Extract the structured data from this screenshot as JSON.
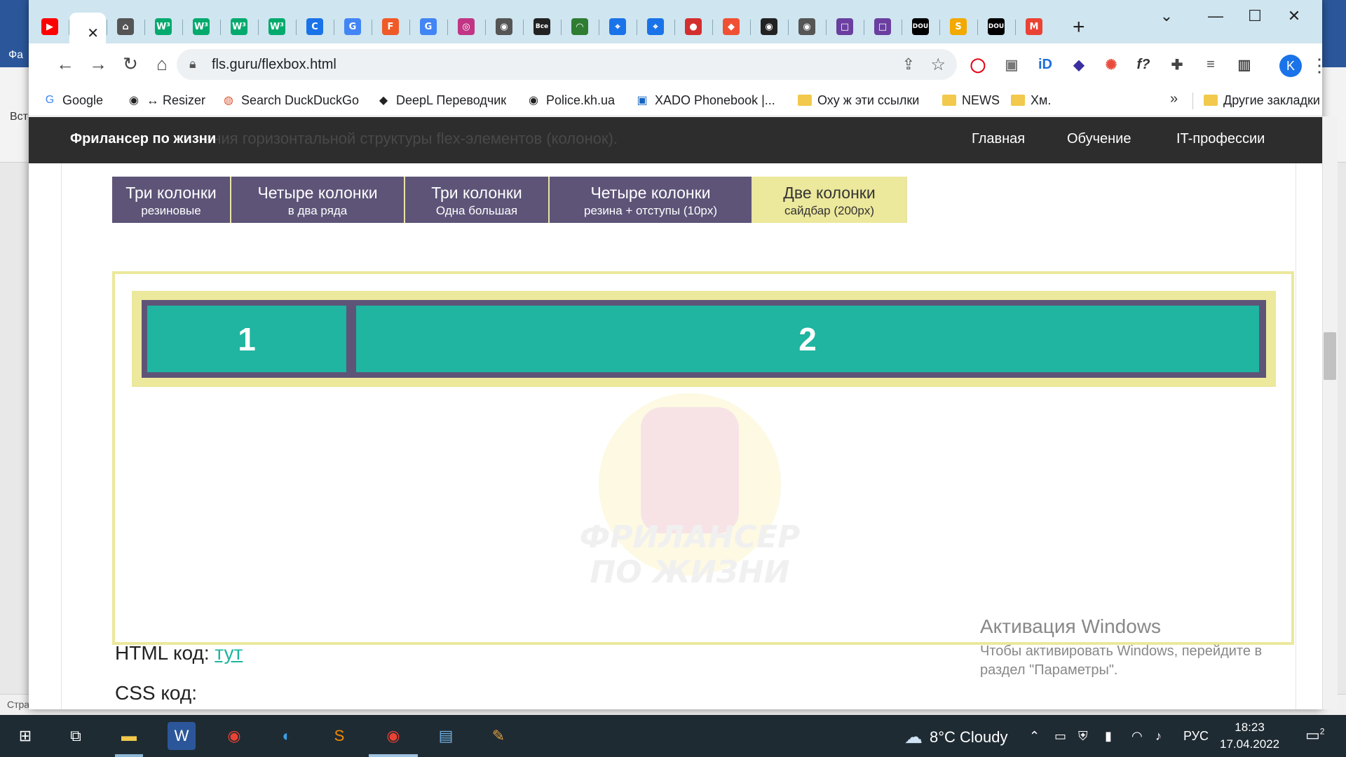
{
  "browser": {
    "url": "fls.guru/flexbox.html",
    "tabs": [
      {
        "icon": "youtube-icon",
        "color": "#ff0000",
        "glyph": "▶"
      },
      {
        "icon": "x-icon",
        "color": "#ffffff",
        "glyph": "",
        "active": true
      },
      {
        "icon": "bag-icon",
        "color": "#555555",
        "glyph": "⌂"
      },
      {
        "icon": "w3schools-icon",
        "color": "#04aa6d",
        "glyph": "W³"
      },
      {
        "icon": "w3schools-icon",
        "color": "#04aa6d",
        "glyph": "W³"
      },
      {
        "icon": "w3schools-icon",
        "color": "#04aa6d",
        "glyph": "W³"
      },
      {
        "icon": "w3schools-icon",
        "color": "#04aa6d",
        "glyph": "W³"
      },
      {
        "icon": "c-icon",
        "color": "#1a73e8",
        "glyph": "C"
      },
      {
        "icon": "translate-icon",
        "color": "#4285f4",
        "glyph": "G"
      },
      {
        "icon": "f-icon",
        "color": "#f05a28",
        "glyph": "F"
      },
      {
        "icon": "google-icon",
        "color": "#4285f4",
        "glyph": "G"
      },
      {
        "icon": "instagram-icon",
        "color": "#c13584",
        "glyph": "◎"
      },
      {
        "icon": "globe-icon",
        "color": "#555555",
        "glyph": "◉"
      },
      {
        "icon": "vse-sto-icon",
        "color": "#222222",
        "glyph": "Все"
      },
      {
        "icon": "android-icon",
        "color": "#2e7d32",
        "glyph": "◠"
      },
      {
        "icon": "map-pin-icon",
        "color": "#1a73e8",
        "glyph": "⌖"
      },
      {
        "icon": "map-pin-icon",
        "color": "#1a73e8",
        "glyph": "⌖"
      },
      {
        "icon": "ladybug-icon",
        "color": "#d32f2f",
        "glyph": "●"
      },
      {
        "icon": "git-icon",
        "color": "#f05033",
        "glyph": "◆"
      },
      {
        "icon": "github-icon",
        "color": "#222222",
        "glyph": "◉"
      },
      {
        "icon": "globe-icon",
        "color": "#555555",
        "glyph": "◉"
      },
      {
        "icon": "square-icon",
        "color": "#6a3fa0",
        "glyph": "□"
      },
      {
        "icon": "square-icon",
        "color": "#6a3fa0",
        "glyph": "□"
      },
      {
        "icon": "dou-icon",
        "color": "#000000",
        "glyph": "DOU"
      },
      {
        "icon": "s-icon",
        "color": "#f2a900",
        "glyph": "S"
      },
      {
        "icon": "dou-icon",
        "color": "#000000",
        "glyph": "DOU"
      },
      {
        "icon": "gmail-icon",
        "color": "#ea4335",
        "glyph": "M"
      }
    ],
    "profile_letter": "K",
    "bookmarks": [
      {
        "label": "Google",
        "icon": "google-icon"
      },
      {
        "label": "↔ Resizer",
        "icon": "globe-icon"
      },
      {
        "label": "Search DuckDuckGo",
        "icon": "duckduckgo-icon"
      },
      {
        "label": "DeepL Переводчик",
        "icon": "deepl-icon"
      },
      {
        "label": "Police.kh.ua",
        "icon": "globe-icon"
      },
      {
        "label": "XADO Phonebook |...",
        "icon": "xado-icon"
      },
      {
        "label": "Оху ж эти ссылки",
        "icon": "folder-icon"
      },
      {
        "label": "NEWS",
        "icon": "folder-icon"
      },
      {
        "label": "Хм.",
        "icon": "folder-icon"
      }
    ],
    "bookmarks_more": "»",
    "other_bookmarks": "Другие закладки"
  },
  "site": {
    "brand": "Фрилансер по жизни",
    "behind_text": "ения горизонтальной структуры flex-элементов (колонок).",
    "nav": [
      "Главная",
      "Обучение",
      "IT-профессии"
    ]
  },
  "demo": {
    "tabs": [
      {
        "title": "Три колонки",
        "subtitle": "резиновые"
      },
      {
        "title": "Четыре колонки",
        "subtitle": "в два ряда"
      },
      {
        "title": "Три колонки",
        "subtitle": "Одна большая"
      },
      {
        "title": "Четыре колонки",
        "subtitle": "резина + отступы (10px)"
      },
      {
        "title": "Две колонки",
        "subtitle": "сайдбар (200px)",
        "selected": true
      }
    ],
    "columns": [
      "1",
      "2"
    ],
    "watermark_text_1": "ФРИЛАНСЕР",
    "watermark_text_2": "ПО ЖИЗНИ"
  },
  "code": {
    "html_label": "HTML код: ",
    "html_link": "тут",
    "css_label": "CSS код:"
  },
  "activation": {
    "title": "Активация Windows",
    "line1": "Чтобы активировать Windows, перейдите в",
    "line2": "раздел \"Параметры\"."
  },
  "taskbar": {
    "weather": "8°C  Cloudy",
    "lang": "РУС",
    "time": "18:23",
    "date": "17.04.2022",
    "notifications": "2"
  },
  "background_app": {
    "left_label_1": "Фа",
    "left_label_2": "Вст",
    "status_left": "Стра"
  },
  "colors": {
    "accent_purple": "#5e5478",
    "accent_teal": "#1fb5a0",
    "accent_yellow": "#ece89c"
  }
}
